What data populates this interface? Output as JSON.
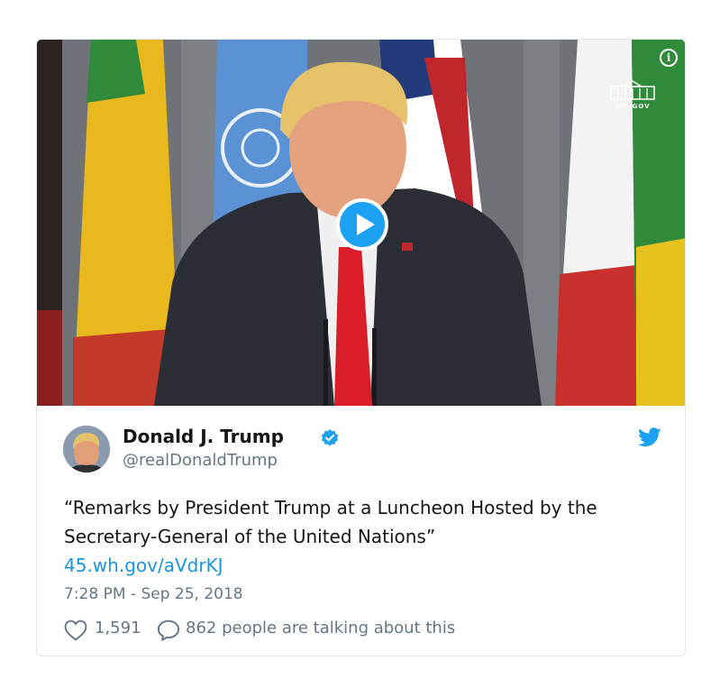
{
  "tweet": {
    "author_name": "Donald J. Trump",
    "handle": "@realDonaldTrump",
    "text": "“Remarks by President Trump at a Luncheon Hosted by the Secretary-General of the United Nations”",
    "link": "45.wh.gov/aVdrKJ",
    "timestamp": "7:28 PM - Sep 25, 2018",
    "likes": "1,591",
    "talking": "862 people are talking about this"
  },
  "media": {
    "watermark": "WH.GOV",
    "info_icon": "i"
  },
  "icons": {
    "verified": "verified-badge-icon",
    "bird": "twitter-bird-icon",
    "heart": "heart-icon",
    "reply": "speech-bubble-icon",
    "play": "play-icon"
  },
  "colors": {
    "accent": "#1da1f2",
    "link": "#1b95e0",
    "muted": "#657786",
    "text": "#14171a"
  }
}
